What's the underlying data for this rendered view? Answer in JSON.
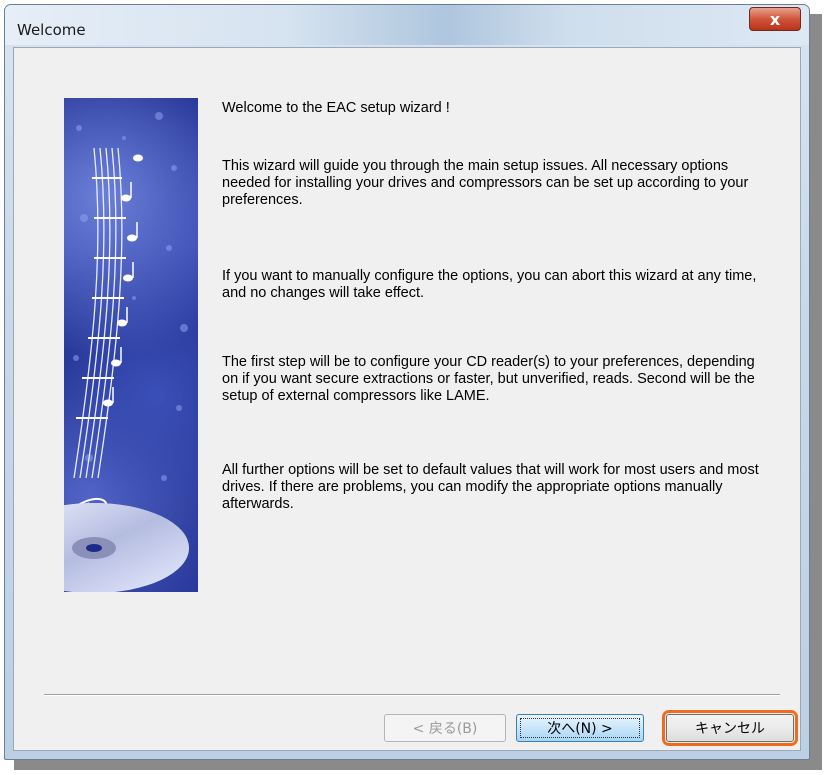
{
  "window": {
    "title": "Welcome",
    "close_label": "x"
  },
  "content": {
    "heading": "Welcome to the EAC setup wizard !",
    "paragraphs": [
      "This wizard will guide you through the main setup issues. All necessary options needed for installing your drives and compressors can be set up according to your preferences.",
      "If you want to manually configure the options, you can abort this wizard at any time, and no changes will take effect.",
      "The first step will be to configure your CD reader(s) to your preferences, depending on if you want secure extractions or faster, but unverified, reads. Second will be the setup of external compressors like LAME.",
      "All further options will be set to default values that will work for most users and most drives. If there are problems, you can modify the appropriate options manually afterwards."
    ]
  },
  "buttons": {
    "back_label": "< 戻る(B)",
    "next_label": "次へ(N) >",
    "cancel_label": "キャンセル"
  },
  "colors": {
    "highlight": "#f26b1d",
    "banner": "#1c2a8c"
  },
  "icons": {
    "banner": "guitar-music-cd-image",
    "close": "close-icon"
  }
}
